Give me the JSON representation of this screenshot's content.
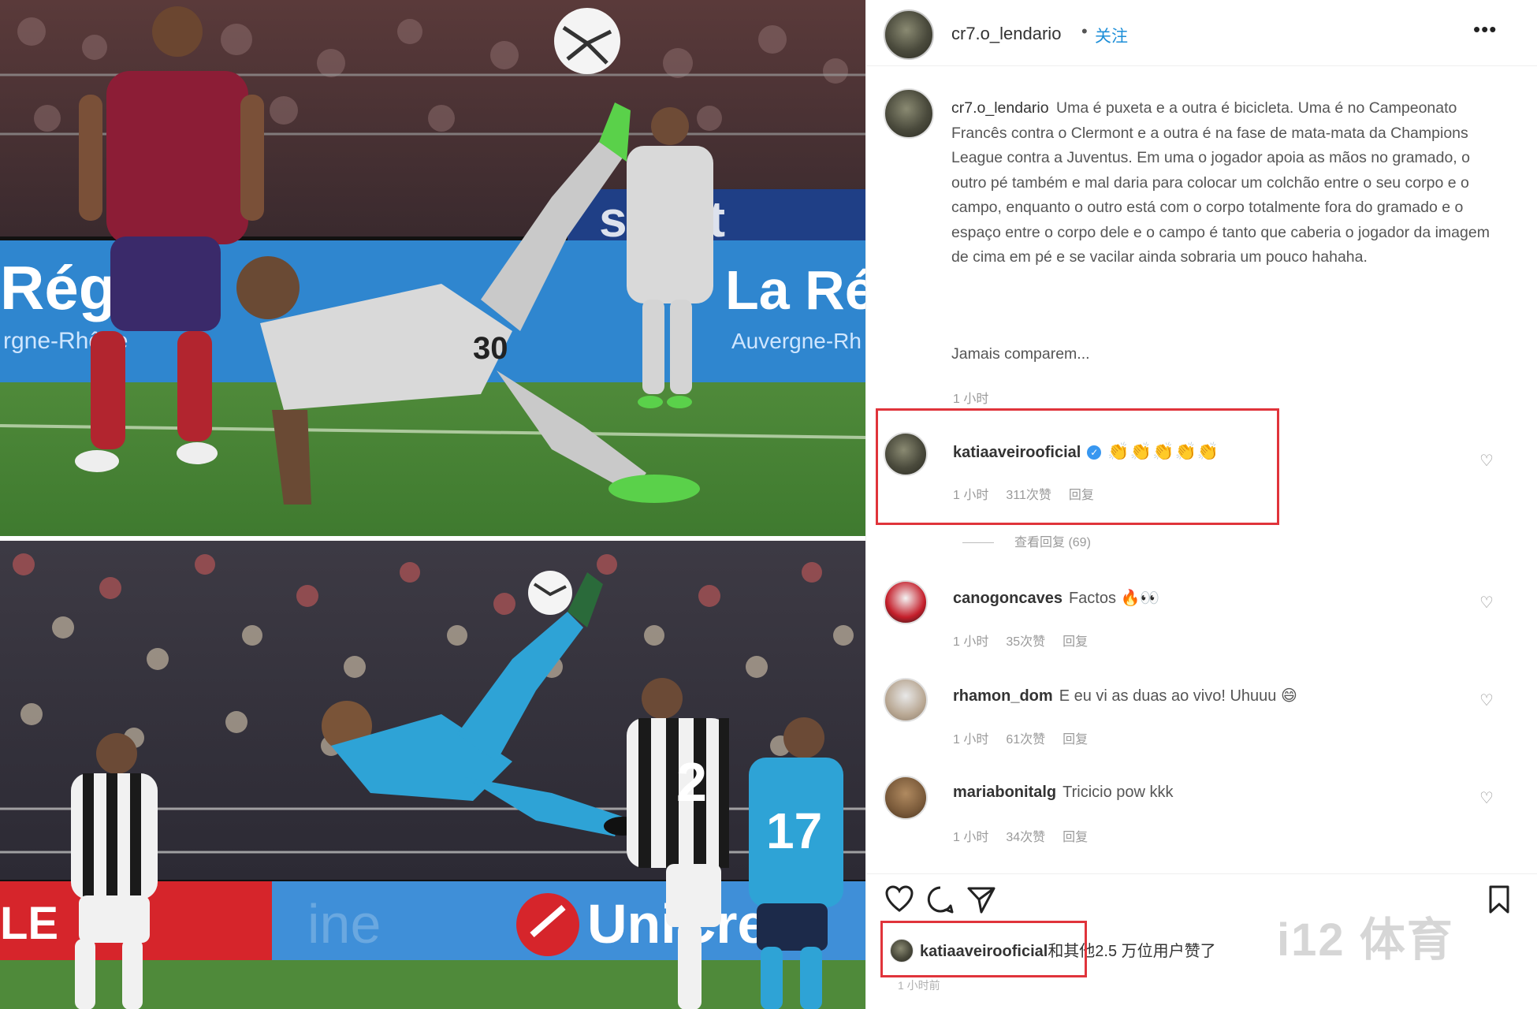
{
  "post_header": {
    "username": "cr7.o_lendario",
    "separator": "•",
    "follow_label": "关注",
    "more_icon": "more-horizontal-icon",
    "more_glyph": "•••"
  },
  "caption": {
    "username": "cr7.o_lendario",
    "text": "Uma é puxeta e a outra é bicicleta. Uma é no Campeonato Francês contra o Clermont e a outra é na fase de mata-mata da Champions League contra a Juventus. Em uma o jogador apoia as mãos no gramado, o outro pé também e mal daria para colocar um colchão entre o seu corpo e o campo, enquanto o outro está com o corpo totalmente fora do gramado e o espaço entre o corpo dele e o campo é tanto que caberia o jogador da imagem de cima em pé e se vacilar ainda sobraria um pouco hahaha.",
    "closing": "Jamais comparem...",
    "time": "1 小时"
  },
  "comments": [
    {
      "username": "katiaaveirooficial",
      "verified": true,
      "verified_glyph": "✓",
      "text": "👏👏👏👏👏",
      "time": "1 小时",
      "likes": "311次赞",
      "reply": "回复",
      "heart_glyph": "♡"
    },
    {
      "username": "canogoncaves",
      "verified": false,
      "text": "Factos 🔥👀",
      "time": "1 小时",
      "likes": "35次赞",
      "reply": "回复",
      "heart_glyph": "♡"
    },
    {
      "username": "rhamon_dom",
      "verified": false,
      "text": "E eu vi as duas ao vivo! Uhuuu 😄",
      "time": "1 小时",
      "likes": "61次赞",
      "reply": "回复",
      "heart_glyph": "♡"
    },
    {
      "username": "mariabonitalg",
      "verified": false,
      "text": "Tricicio pow kkk",
      "time": "1 小时",
      "likes": "34次赞",
      "reply": "回复",
      "heart_glyph": "♡"
    }
  ],
  "view_replies": "查看回复 (69)",
  "actions": {
    "like_icon": "heart-icon",
    "comment_icon": "comment-icon",
    "share_icon": "send-icon",
    "save_icon": "bookmark-icon"
  },
  "likes_line": {
    "username": "katiaaveirooficial",
    "rest": "和其他2.5 万位用户赞了"
  },
  "post_time": "1 小时前",
  "watermark": "i12 体育",
  "colors": {
    "highlight_box": "#e0343b",
    "follow_link": "#1e8fd8",
    "verified_badge": "#3897f0",
    "messi_kit": "#d9d9d9",
    "clermont_kit": "#8c1d36",
    "ronaldo_kit": "#2ea3d6",
    "juventus_kit": "#1a1a1a",
    "pitch": "#4f8a3a"
  },
  "photos": {
    "top_banner_left": "Régi",
    "top_banner_right": "La Ré",
    "top_banner_sub_left": "rgne-Rhône",
    "top_banner_sub_right": "Auvergne-Rh",
    "top_back_board": "sport",
    "bottom_banner_left": "LE",
    "bottom_banner_mid": "ine",
    "bottom_banner_right": "UniCre",
    "number_juve": "2",
    "number_real": "17",
    "number_messi": "30"
  }
}
